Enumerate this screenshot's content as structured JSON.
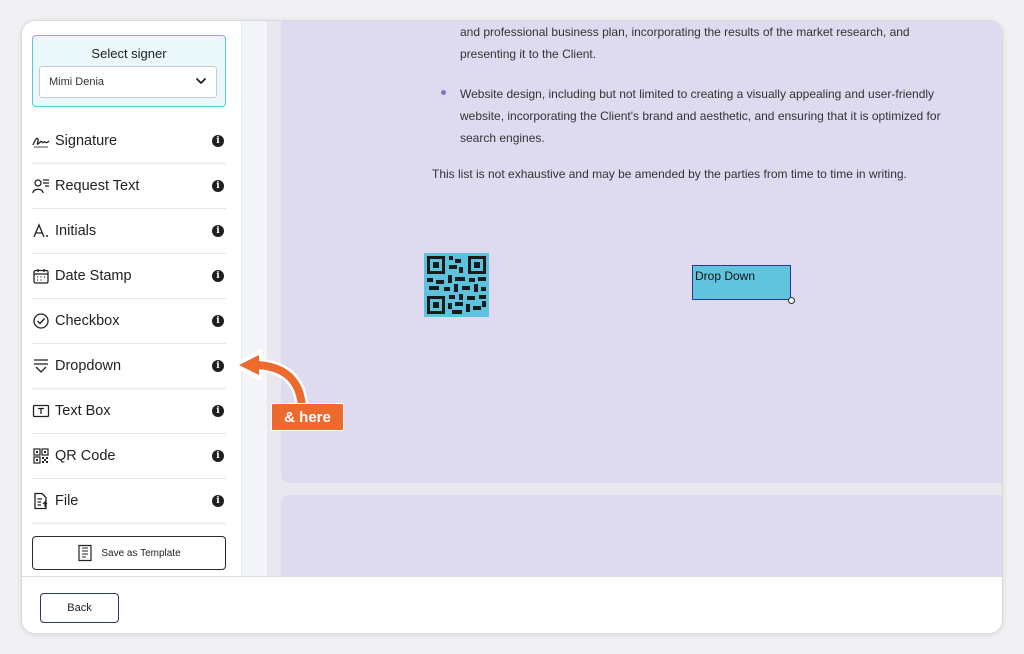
{
  "signer": {
    "title": "Select signer",
    "selected": "Mimi Denia"
  },
  "tools": [
    {
      "label": "Signature",
      "icon": "signature-icon"
    },
    {
      "label": "Request Text",
      "icon": "request-text-icon"
    },
    {
      "label": "Initials",
      "icon": "initials-icon"
    },
    {
      "label": "Date Stamp",
      "icon": "calendar-icon"
    },
    {
      "label": "Checkbox",
      "icon": "checkbox-icon"
    },
    {
      "label": "Dropdown",
      "icon": "dropdown-icon"
    },
    {
      "label": "Text Box",
      "icon": "textbox-icon"
    },
    {
      "label": "QR Code",
      "icon": "qr-code-icon"
    },
    {
      "label": "File",
      "icon": "file-icon"
    }
  ],
  "info_glyph": "i",
  "save_template_label": "Save as Template",
  "document": {
    "para_continued": "and professional business plan, incorporating the results of the market research, and presenting it to the Client.",
    "bullet": "Website design, including but not limited to creating a visually appealing and user-friendly website, incorporating the Client's brand and aesthetic, and ensuring that it is optimized for search engines.",
    "list_note": "This list is not exhaustive and may be amended by the parties from time to time in writing."
  },
  "dropdown_field_label": "Drop Down",
  "footer": {
    "back_label": "Back"
  },
  "annotation": {
    "label": "& here",
    "color": "#ec6a2e"
  },
  "colors": {
    "accent": "#5ec3dc",
    "field_fill": "#60c4de",
    "page": "#dedaf0"
  }
}
